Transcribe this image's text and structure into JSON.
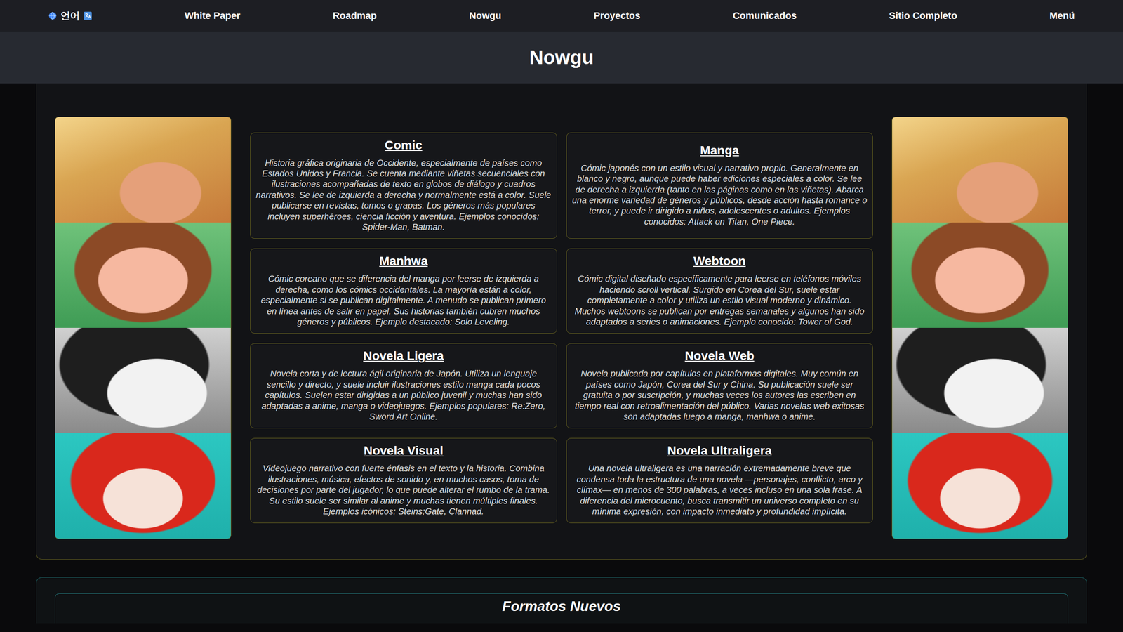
{
  "nav": {
    "language": {
      "label": "언어"
    },
    "items": [
      "White Paper",
      "Roadmap",
      "Nowgu",
      "Proyectos",
      "Comunicados",
      "Sitio Completo",
      "Menú"
    ]
  },
  "page": {
    "title": "Nowgu"
  },
  "formats": [
    {
      "title": "Comic",
      "description": "Historia gráfica originaria de Occidente, especialmente de países como Estados Unidos y Francia. Se cuenta mediante viñetas secuenciales con ilustraciones acompañadas de texto en globos de diálogo y cuadros narrativos. Se lee de izquierda a derecha y normalmente está a color. Suele publicarse en revistas, tomos o grapas. Los géneros más populares incluyen superhéroes, ciencia ficción y aventura. Ejemplos conocidos: Spider-Man, Batman."
    },
    {
      "title": "Manga",
      "description": "Cómic japonés con un estilo visual y narrativo propio. Generalmente en blanco y negro, aunque puede haber ediciones especiales a color. Se lee de derecha a izquierda (tanto en las páginas como en las viñetas). Abarca una enorme variedad de géneros y públicos, desde acción hasta romance o terror, y puede ir dirigido a niños, adolescentes o adultos. Ejemplos conocidos: Attack on Titan, One Piece."
    },
    {
      "title": "Manhwa",
      "description": "Cómic coreano que se diferencia del manga por leerse de izquierda a derecha, como los cómics occidentales. La mayoría están a color, especialmente si se publican digitalmente. A menudo se publican primero en línea antes de salir en papel. Sus historias también cubren muchos géneros y públicos. Ejemplo destacado: Solo Leveling."
    },
    {
      "title": "Webtoon",
      "description": "Cómic digital diseñado específicamente para leerse en teléfonos móviles haciendo scroll vertical. Surgido en Corea del Sur, suele estar completamente a color y utiliza un estilo visual moderno y dinámico. Muchos webtoons se publican por entregas semanales y algunos han sido adaptados a series o animaciones. Ejemplo conocido: Tower of God."
    },
    {
      "title": "Novela Ligera",
      "description": "Novela corta y de lectura ágil originaria de Japón. Utiliza un lenguaje sencillo y directo, y suele incluir ilustraciones estilo manga cada pocos capítulos. Suelen estar dirigidas a un público juvenil y muchas han sido adaptadas a anime, manga o videojuegos. Ejemplos populares: Re:Zero, Sword Art Online."
    },
    {
      "title": "Novela Web",
      "description": "Novela publicada por capítulos en plataformas digitales. Muy común en países como Japón, Corea del Sur y China. Su publicación suele ser gratuita o por suscripción, y muchas veces los autores las escriben en tiempo real con retroalimentación del público. Varias novelas web exitosas son adaptadas luego a manga, manhwa o anime."
    },
    {
      "title": "Novela Visual",
      "description": "Videojuego narrativo con fuerte énfasis en el texto y la historia. Combina ilustraciones, música, efectos de sonido y, en muchos casos, toma de decisiones por parte del jugador, lo que puede alterar el rumbo de la trama. Su estilo suele ser similar al anime y muchas tienen múltiples finales. Ejemplos icónicos: Steins;Gate, Clannad."
    },
    {
      "title": "Novela Ultraligera",
      "description": "Una novela ultraligera es una narración extremadamente breve que condensa toda la estructura de una novela —personajes, conflicto, arco y clímax— en menos de 300 palabras, a veces incluso en una sola frase. A diferencia del microcuento, busca transmitir un universo completo en su mínima expresión, con impacto inmediato y profundidad implícita."
    }
  ],
  "next_section": {
    "title": "Formatos Nuevos"
  }
}
